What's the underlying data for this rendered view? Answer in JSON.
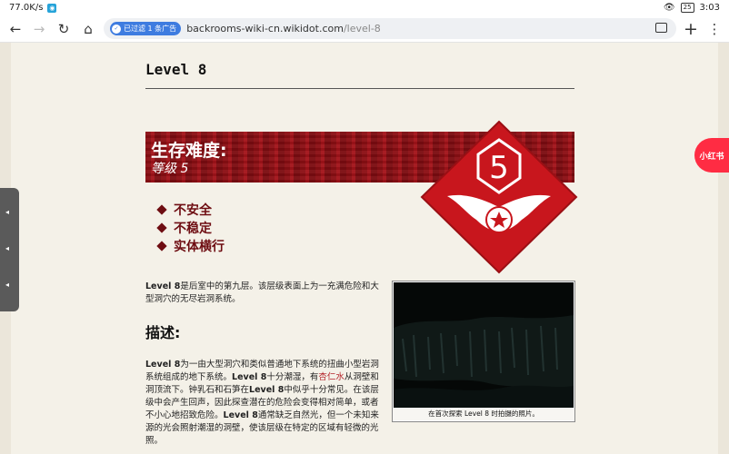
{
  "statusbar": {
    "speed": "77.0K/s",
    "battery": "25",
    "time": "3:03"
  },
  "browser": {
    "ad_filter_label": "已过滤 1 条广告",
    "url_host": "backrooms-wiki-cn.wikidot.com",
    "url_path": "/level-8"
  },
  "page": {
    "title": "Level 8",
    "banner": {
      "heading": "生存难度:",
      "sublevel": "等级 5",
      "badge_number": "5"
    },
    "features": [
      "不安全",
      "不稳定",
      "实体横行"
    ],
    "intro_bold": "Level 8",
    "intro_rest": "是后室中的第九层。该层级表面上为一充满危险和大型洞穴的无尽岩洞系统。",
    "description_heading": "描述:",
    "desc": {
      "part1_bold": "Level 8",
      "part1": "为一由大型洞穴和类似普通地下系统的扭曲小型岩洞系统组成的地下系统。",
      "part2_bold": "Level 8",
      "part2": "十分潮湿，有",
      "link": "杏仁水",
      "part3": "从洞壁和洞顶流下。钟乳石和石笋在",
      "part3_bold": "Level 8",
      "part4": "中似乎十分常见。在该层级中会产生回声，因此探查潜在的危险会变得相对简单，或者不小心地招致危险。",
      "part5_bold": "Level 8",
      "part5": "通常缺乏自然光，但一个未知来源的光会照射潮湿的洞壁，使该层级在特定的区域有轻微的光照。"
    },
    "photo_caption": "在首次探索 Level 8 时拍摄的照片。"
  },
  "floating_button": "小红书",
  "colors": {
    "danger_red": "#8b0f14",
    "badge_red": "#c8161d",
    "accent_link": "#b5252c"
  }
}
